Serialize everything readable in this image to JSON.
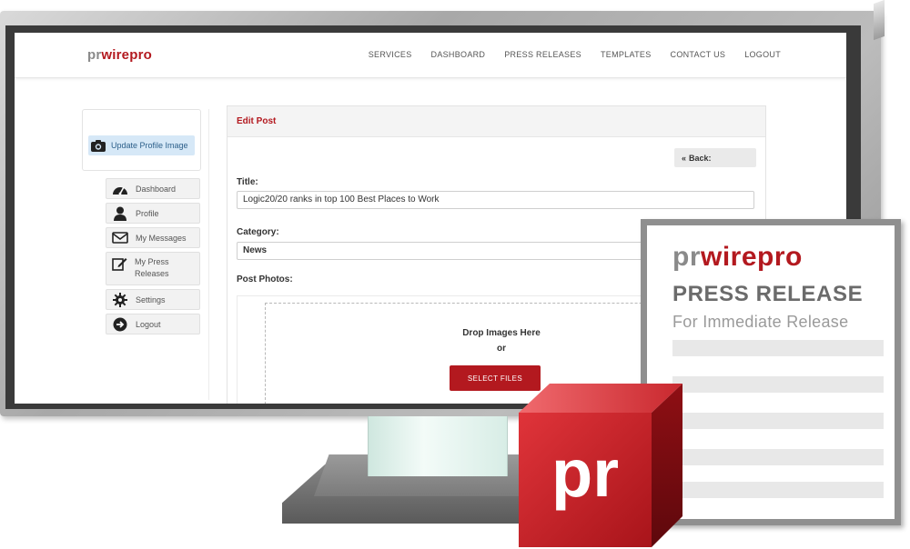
{
  "site": {
    "brand_prefix": "pr",
    "brand_suffix": "wirepro",
    "nav": [
      "SERVICES",
      "DASHBOARD",
      "PRESS RELEASES",
      "TEMPLATES",
      "CONTACT US",
      "LOGOUT"
    ]
  },
  "sidebar": {
    "update_profile_image": "Update Profile Image",
    "items": [
      {
        "label": "Dashboard",
        "icon": "dashboard-icon"
      },
      {
        "label": "Profile",
        "icon": "user-icon"
      },
      {
        "label": "My Messages",
        "icon": "envelope-icon"
      },
      {
        "label": "My Press Releases",
        "icon": "edit-icon"
      },
      {
        "label": "Settings",
        "icon": "gear-icon"
      },
      {
        "label": "Logout",
        "icon": "logout-icon"
      }
    ]
  },
  "edit_post": {
    "heading": "Edit Post",
    "back_label": "Back:",
    "title_label": "Title:",
    "title_value": "Logic20/20 ranks in top 100 Best Places to Work",
    "category_label": "Category:",
    "category_value": "News",
    "photos_label": "Post Photos:",
    "drop_text": "Drop Images Here",
    "or_text": "or",
    "select_files": "SELECT FILES"
  },
  "press_release_doc": {
    "brand_prefix": "pr",
    "brand_suffix": "wirepro",
    "title": "PRESS RELEASE",
    "subtitle": "For Immediate Release"
  },
  "logo_cube": {
    "text": "pr"
  },
  "colors": {
    "brand_red": "#b3191f",
    "brand_gray": "#8a8a8a"
  }
}
